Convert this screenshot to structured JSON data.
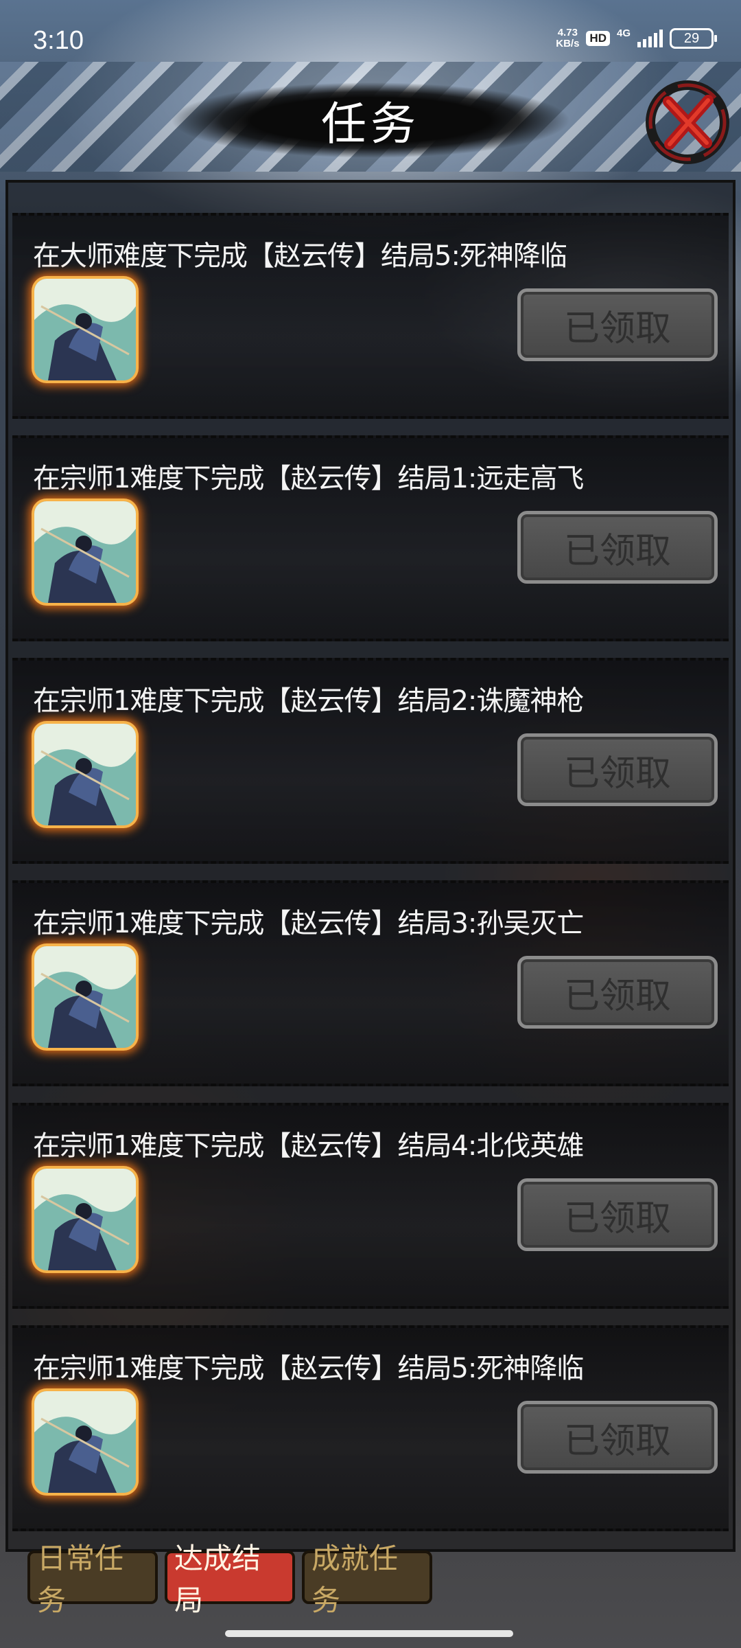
{
  "status_bar": {
    "time": "3:10",
    "speed_value": "4.73",
    "speed_unit": "KB/s",
    "hd": "HD",
    "network": "4G",
    "battery": "29"
  },
  "header": {
    "title": "任务"
  },
  "tasks": [
    {
      "description": "在大师难度下完成【赵云传】结局5:死神降临",
      "button_label": "已领取"
    },
    {
      "description": "在宗师1难度下完成【赵云传】结局1:远走高飞",
      "button_label": "已领取"
    },
    {
      "description": "在宗师1难度下完成【赵云传】结局2:诛魔神枪",
      "button_label": "已领取"
    },
    {
      "description": "在宗师1难度下完成【赵云传】结局3:孙吴灭亡",
      "button_label": "已领取"
    },
    {
      "description": "在宗师1难度下完成【赵云传】结局4:北伐英雄",
      "button_label": "已领取"
    },
    {
      "description": "在宗师1难度下完成【赵云传】结局5:死神降临",
      "button_label": "已领取"
    }
  ],
  "tabs": [
    {
      "label": "日常任务"
    },
    {
      "label": "达成结局"
    },
    {
      "label": "成就任务"
    }
  ],
  "colors": {
    "active_tab": "#c93a2f",
    "inactive_tab": "#4a3c25",
    "reward_glow": "#f7b34a"
  }
}
